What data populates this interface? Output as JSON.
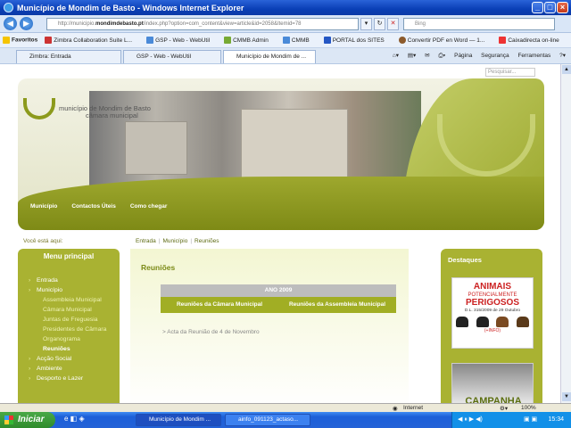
{
  "window": {
    "title": "Município de Mondim de Basto - Windows Internet Explorer"
  },
  "address": {
    "url_prefix": "http://municipio.",
    "url_domain": "mondimdebasto.pt",
    "url_rest": "/index.php?option=com_content&view=article&id=2058&Itemid=78",
    "search_placeholder": "Bing"
  },
  "favorites": {
    "label": "Favoritos",
    "items": [
      "Zimbra Collaboration Suite L...",
      "GSP - Web - WebUtil",
      "CMMB Admin",
      "CMMB",
      "PORTAL dos SITES",
      "Convertir PDF en Word — 1...",
      "Caixadirecta on-line"
    ]
  },
  "tabs": [
    "Zimbra: Entrada",
    "GSP - Web - WebUtil",
    "Município de Mondim de ..."
  ],
  "tools": {
    "page": "Página",
    "security": "Segurança",
    "tools": "Ferramentas"
  },
  "site": {
    "search_placeholder": "Pesquisar...",
    "logo_line1": "município de Mondim de Basto",
    "logo_line2": "câmara municipal",
    "nav": [
      "Município",
      "Contactos Úteis",
      "Como chegar"
    ],
    "breadcrumb_label": "Você está aqui:",
    "breadcrumb": [
      "Entrada",
      "Município",
      "Reuniões"
    ],
    "menu_title": "Menu principal",
    "menu": [
      {
        "label": "Entrada",
        "type": "item"
      },
      {
        "label": "Município",
        "type": "item"
      },
      {
        "label": "Assembleia Municipal",
        "type": "sub"
      },
      {
        "label": "Câmara Municipal",
        "type": "sub"
      },
      {
        "label": "Juntas de Freguesia",
        "type": "sub"
      },
      {
        "label": "Presidentes de Câmara",
        "type": "sub"
      },
      {
        "label": "Organograma",
        "type": "sub"
      },
      {
        "label": "Reuniões",
        "type": "current"
      },
      {
        "label": "Acção Social",
        "type": "item"
      },
      {
        "label": "Ambiente",
        "type": "item"
      },
      {
        "label": "Desporto e Lazer",
        "type": "item"
      }
    ],
    "content_title": "Reuniões",
    "table_header": "ANO 2009",
    "table_col1": "Reuniões da Câmara Municipal",
    "table_col2": "Reuniões da Assembleia Municipal",
    "acta_link": "> Acta da Reunião de 4 de Novembro",
    "destaques_title": "Destaques",
    "banner1": {
      "line1": "ANIMAIS",
      "line2": "POTENCIALMENTE",
      "line3": "PERIGOSOS",
      "line4": "D.L. 315/2009 de 29 Outubro",
      "line5": "(+INFO)"
    },
    "banner2": "CAMPANHA"
  },
  "status": {
    "zone": "Internet",
    "zoom": "100%"
  },
  "taskbar": {
    "start": "Iniciar",
    "tasks": [
      "Município de Mondim ...",
      "ainfo_091123_actaso..."
    ],
    "clock": "15:34"
  }
}
